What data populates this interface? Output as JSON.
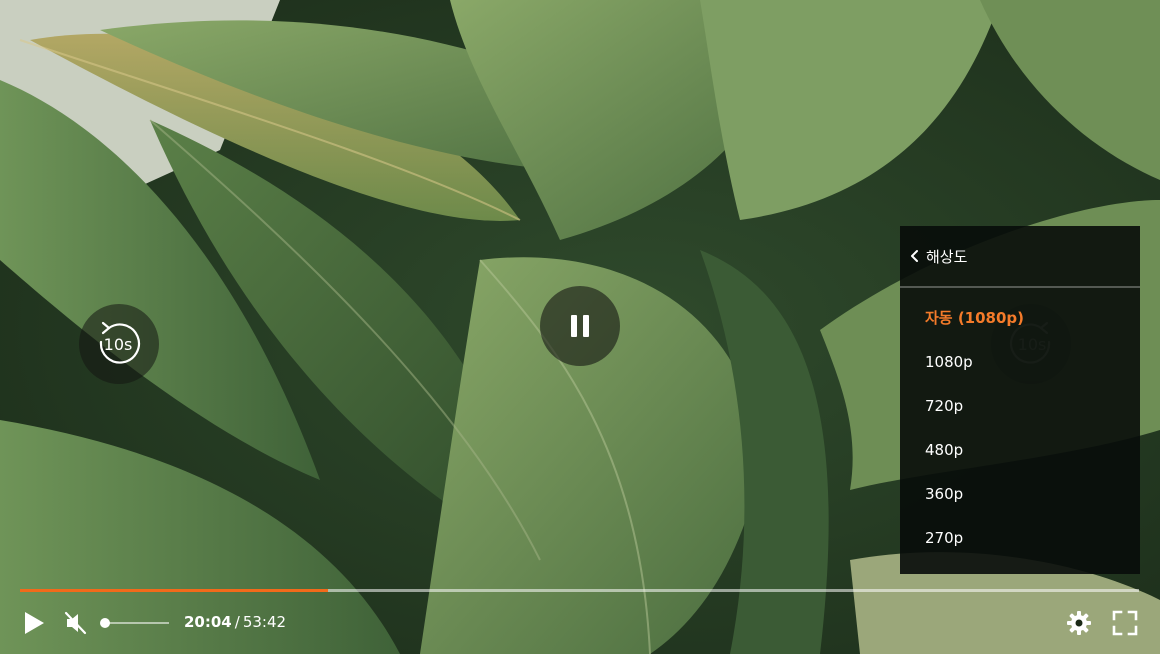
{
  "player": {
    "skip_back_label": "10s",
    "skip_forward_label": "10s",
    "progress_fraction": 0.275,
    "volume_fraction": 0.0,
    "muted": true,
    "state": "playing"
  },
  "time": {
    "current": "20:04",
    "separator": "/",
    "duration": "53:42"
  },
  "resolution_menu": {
    "title": "해상도",
    "selected_index": 0,
    "options": [
      "자동 (1080p)",
      "1080p",
      "720p",
      "480p",
      "360p",
      "270p"
    ]
  },
  "icons": {
    "rewind": "rewind-10-icon",
    "forward": "forward-10-icon",
    "pause": "pause-icon",
    "play": "play-icon",
    "mute": "muted-speaker-icon",
    "settings": "gear-icon",
    "fullscreen": "fullscreen-icon",
    "back": "chevron-left-icon"
  },
  "colors": {
    "accent": "#f26a1a",
    "selected_text": "#f57b2a",
    "menu_bg": "#080c0a"
  }
}
